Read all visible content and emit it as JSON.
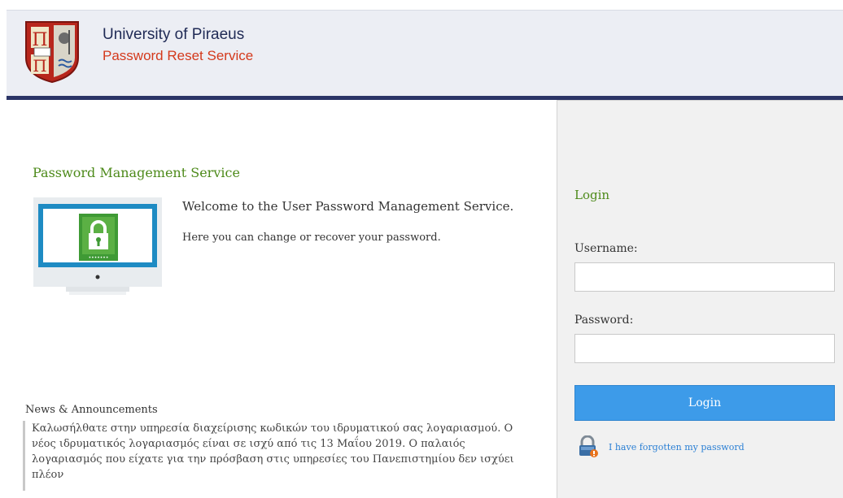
{
  "header": {
    "title": "University of Piraeus",
    "subtitle": "Password Reset Service"
  },
  "main": {
    "section_title": "Password Management Service",
    "welcome": "Welcome to the User Password Management Service.",
    "description": "Here you can change or recover your password.",
    "news_title": "News & Announcements",
    "news_text": "Καλωσήλθατε στην υπηρεσία διαχείρισης κωδικών του ιδρυματικού σας λογαριασμού. Ο νέος ιδρυματικός λογαριασμός είναι σε ισχύ από τις 13 Μαΐου 2019. Ο παλαιός λογαριασμός που είχατε για την πρόσβαση στις υπηρεσίες του Πανεπιστημίου δεν ισχύει πλέον"
  },
  "login": {
    "title": "Login",
    "username_label": "Username:",
    "username_value": "",
    "password_label": "Password:",
    "password_value": "",
    "button_label": "Login",
    "forgot_label": "I have forgotten my password"
  },
  "colors": {
    "accent_green": "#4d8a1a",
    "brand_navy": "#2b3466",
    "brand_red": "#d4391c",
    "button_blue": "#3d9be9",
    "link_blue": "#2a7fd4"
  },
  "icons": {
    "logo": "university-crest-icon",
    "monitor": "monitor-lock-icon",
    "forgot": "lock-warning-icon"
  }
}
